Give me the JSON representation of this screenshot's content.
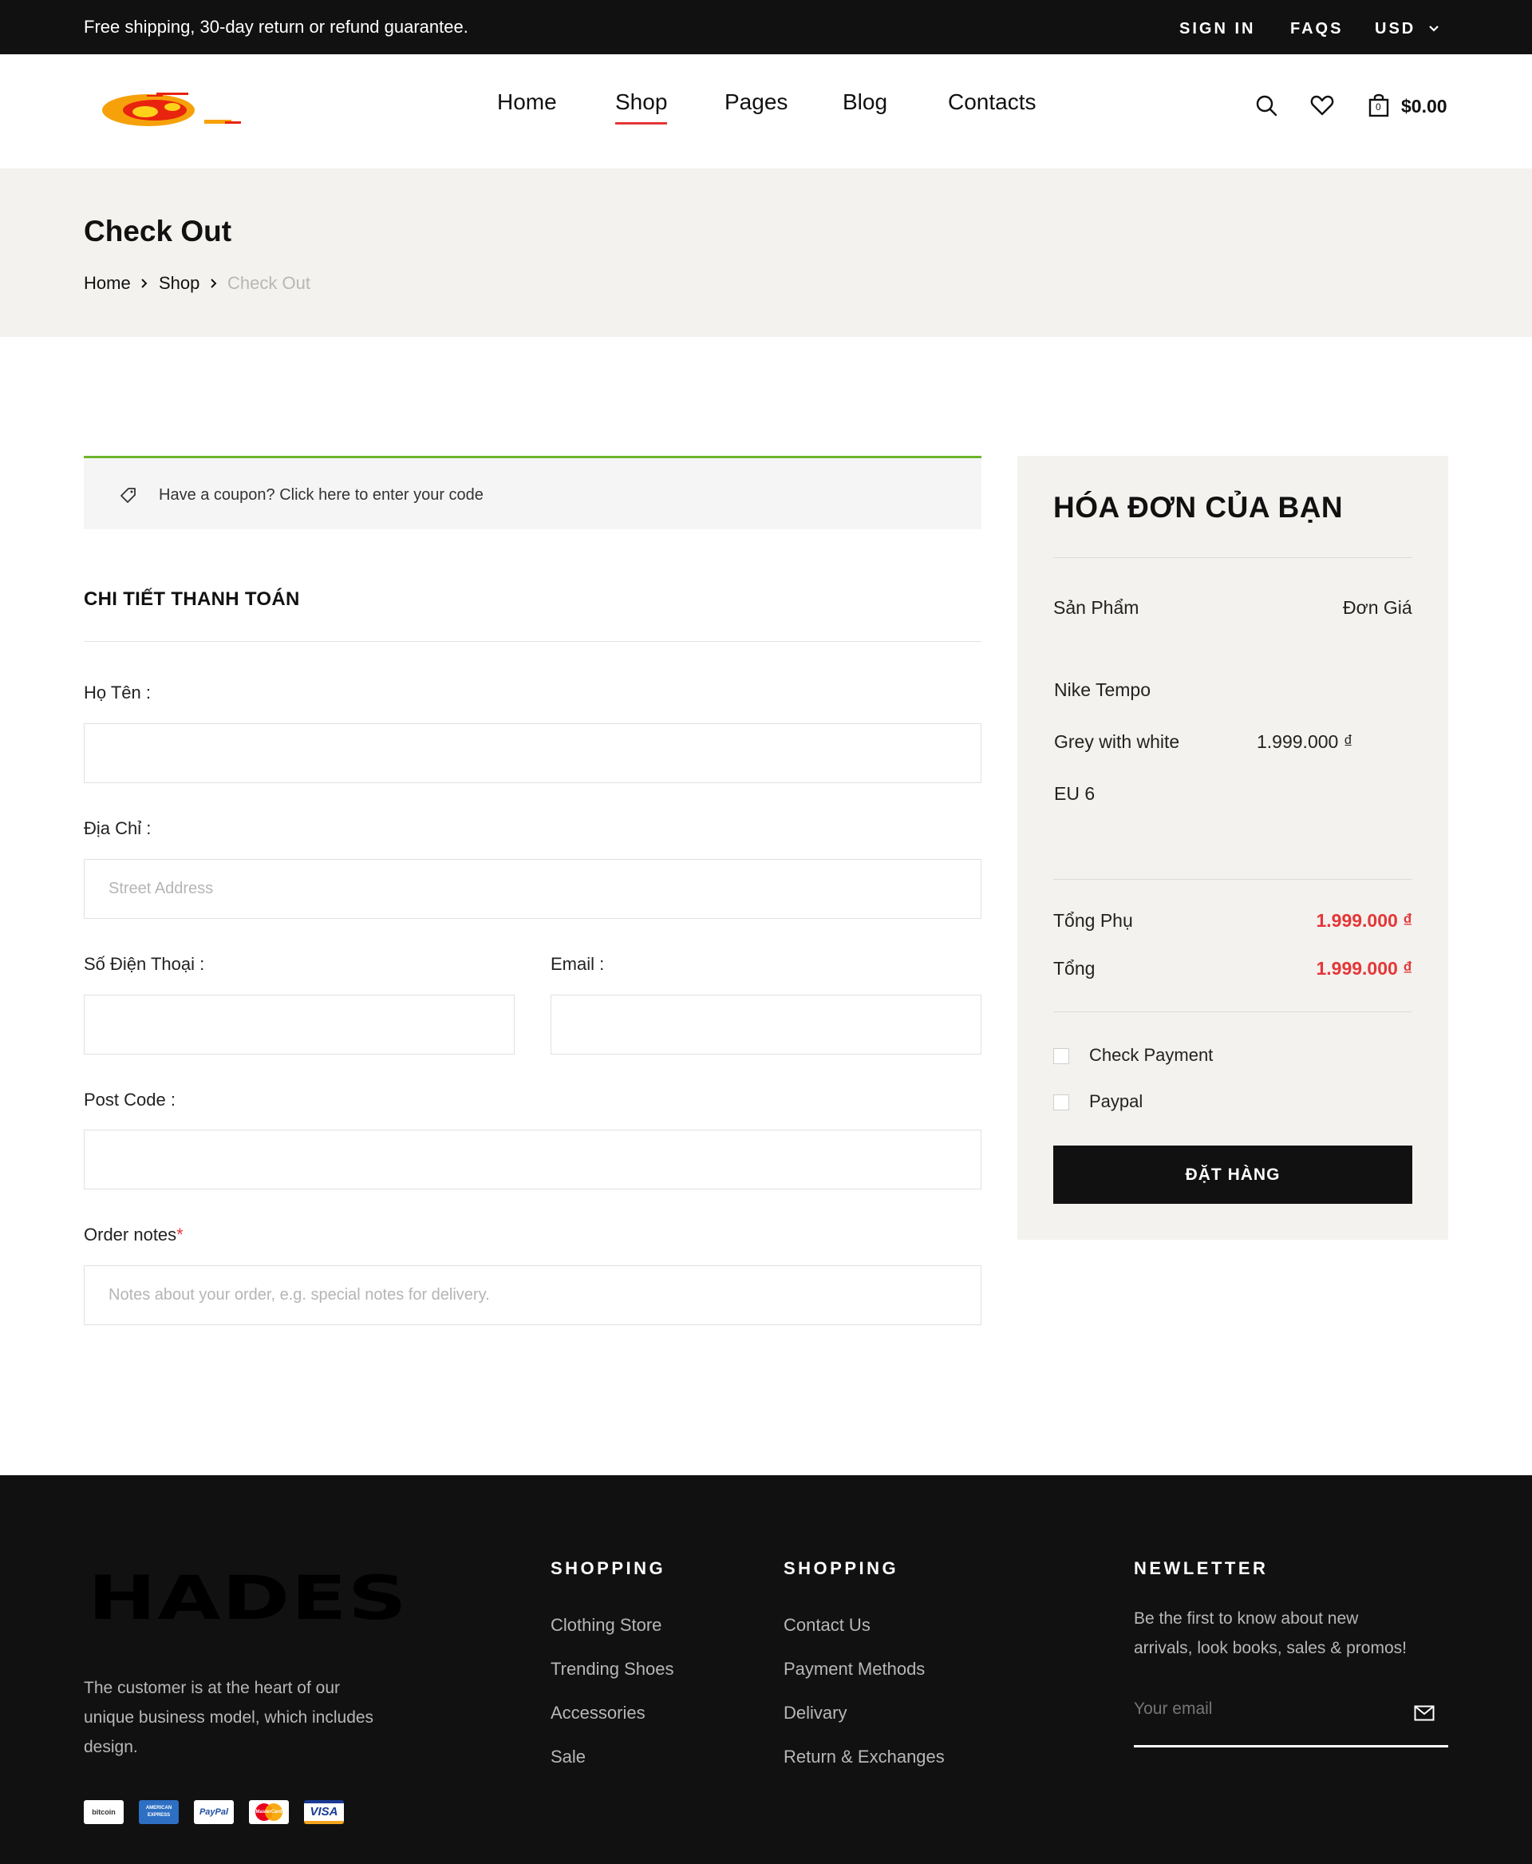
{
  "topbar": {
    "promo": "Free shipping, 30-day return or refund guarantee.",
    "sign_in": "SIGN IN",
    "faqs": "FAQS",
    "currency": "USD"
  },
  "nav": {
    "items": [
      "Home",
      "Shop",
      "Pages",
      "Blog",
      "Contacts"
    ],
    "active": "Shop",
    "cart_count": "0",
    "cart_total": "$0.00"
  },
  "page": {
    "title": "Check Out",
    "breadcrumb": [
      "Home",
      "Shop",
      "Check Out"
    ]
  },
  "coupon": {
    "text": "Have a coupon? Click here to enter your code"
  },
  "billing": {
    "title": "CHI TIẾT THANH TOÁN",
    "name_label": "Họ Tên :",
    "address_label": "Địa Chỉ :",
    "address_placeholder": "Street Address",
    "phone_label": "Số Điện Thoại :",
    "email_label": "Email :",
    "postcode_label": "Post Code :",
    "notes_label": "Order notes",
    "notes_required": "*",
    "notes_placeholder": "Notes about your order, e.g. special notes for delivery."
  },
  "order": {
    "title": "HÓA ĐƠN CỦA BẠN",
    "col_product": "Sản Phẩm",
    "col_price": "Đơn Giá",
    "product_name": "Nike Tempo",
    "product_color": "Grey with white",
    "product_size": "EU 6",
    "product_price": "1.999.000 ₫",
    "subtotal_label": "Tổng Phụ",
    "subtotal_value": "1.999.000 ₫",
    "total_label": "Tổng",
    "total_value": "1.999.000 ₫",
    "payment_options": [
      "Check Payment",
      "Paypal"
    ],
    "place_order": "ĐẶT HÀNG"
  },
  "footer": {
    "brand": "HADES",
    "description": [
      "The customer is at the heart of our",
      "unique business model, which includes",
      "design."
    ],
    "col1_title": "SHOPPING",
    "col1_links": [
      "Clothing Store",
      "Trending Shoes",
      "Accessories",
      "Sale"
    ],
    "col2_title": "SHOPPING",
    "col2_links": [
      "Contact Us",
      "Payment Methods",
      "Delivary",
      "Return & Exchanges"
    ],
    "newsletter_title": "NEWLETTER",
    "newsletter_text": [
      "Be the first to know about new",
      "arrivals, look books, sales & promos!"
    ],
    "email_placeholder": "Your email",
    "payment_cards": [
      "bitcoin",
      "AMERICAN EXPRESS",
      "PayPal",
      "MasterCard",
      "VISA"
    ]
  },
  "colors": {
    "accent": "#e53637",
    "dark": "#111111",
    "band": "#f3f2ee",
    "coupon_border": "#6cb52d"
  }
}
